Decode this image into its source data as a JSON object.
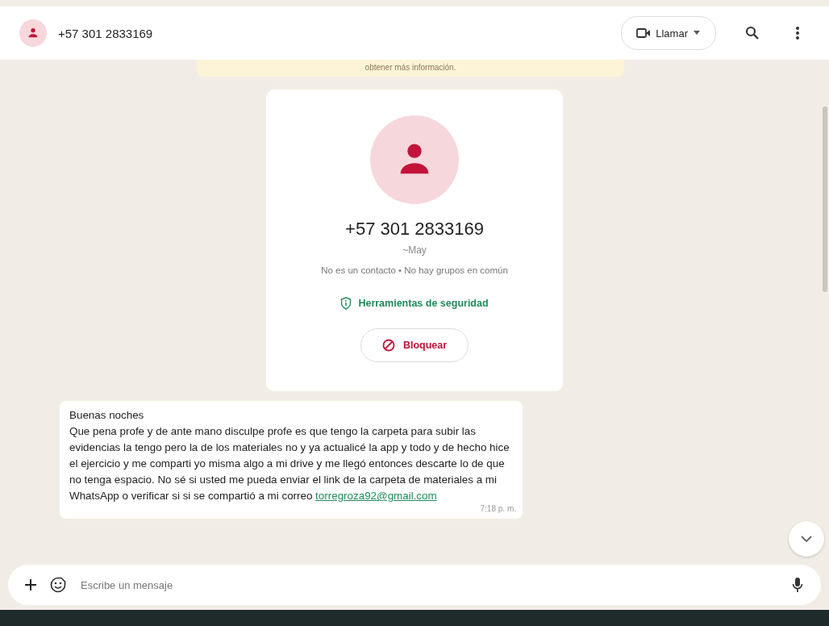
{
  "header": {
    "title": "+57 301 2833169",
    "call_button": "Llamar"
  },
  "notice": {
    "text": "obtener más información."
  },
  "contact_card": {
    "phone": "+57 301 2833169",
    "name": "~May",
    "info": "No es un contacto • No hay grupos en común",
    "security_link": "Herramientas de seguridad",
    "block_button": "Bloquear"
  },
  "message": {
    "greeting": "Buenas noches",
    "text": "Que pena profe y de ante mano disculpe profe es que tengo la carpeta para subir las evidencias la tengo pero la de los materiales no y ya actualicé la app y todo y de hecho hice el ejercicio y me comparti yo misma algo a mi drive y me llegó entonces descarte lo de que no tenga espacio. No sé si usted me pueda enviar el link de la carpeta de materiales a mi WhatsApp o verificar si si se compartió a mi correo",
    "link": "torregroza92@gmail.com",
    "time": "7:18 p. m."
  },
  "composer": {
    "placeholder": "Escribe un mensaje"
  }
}
